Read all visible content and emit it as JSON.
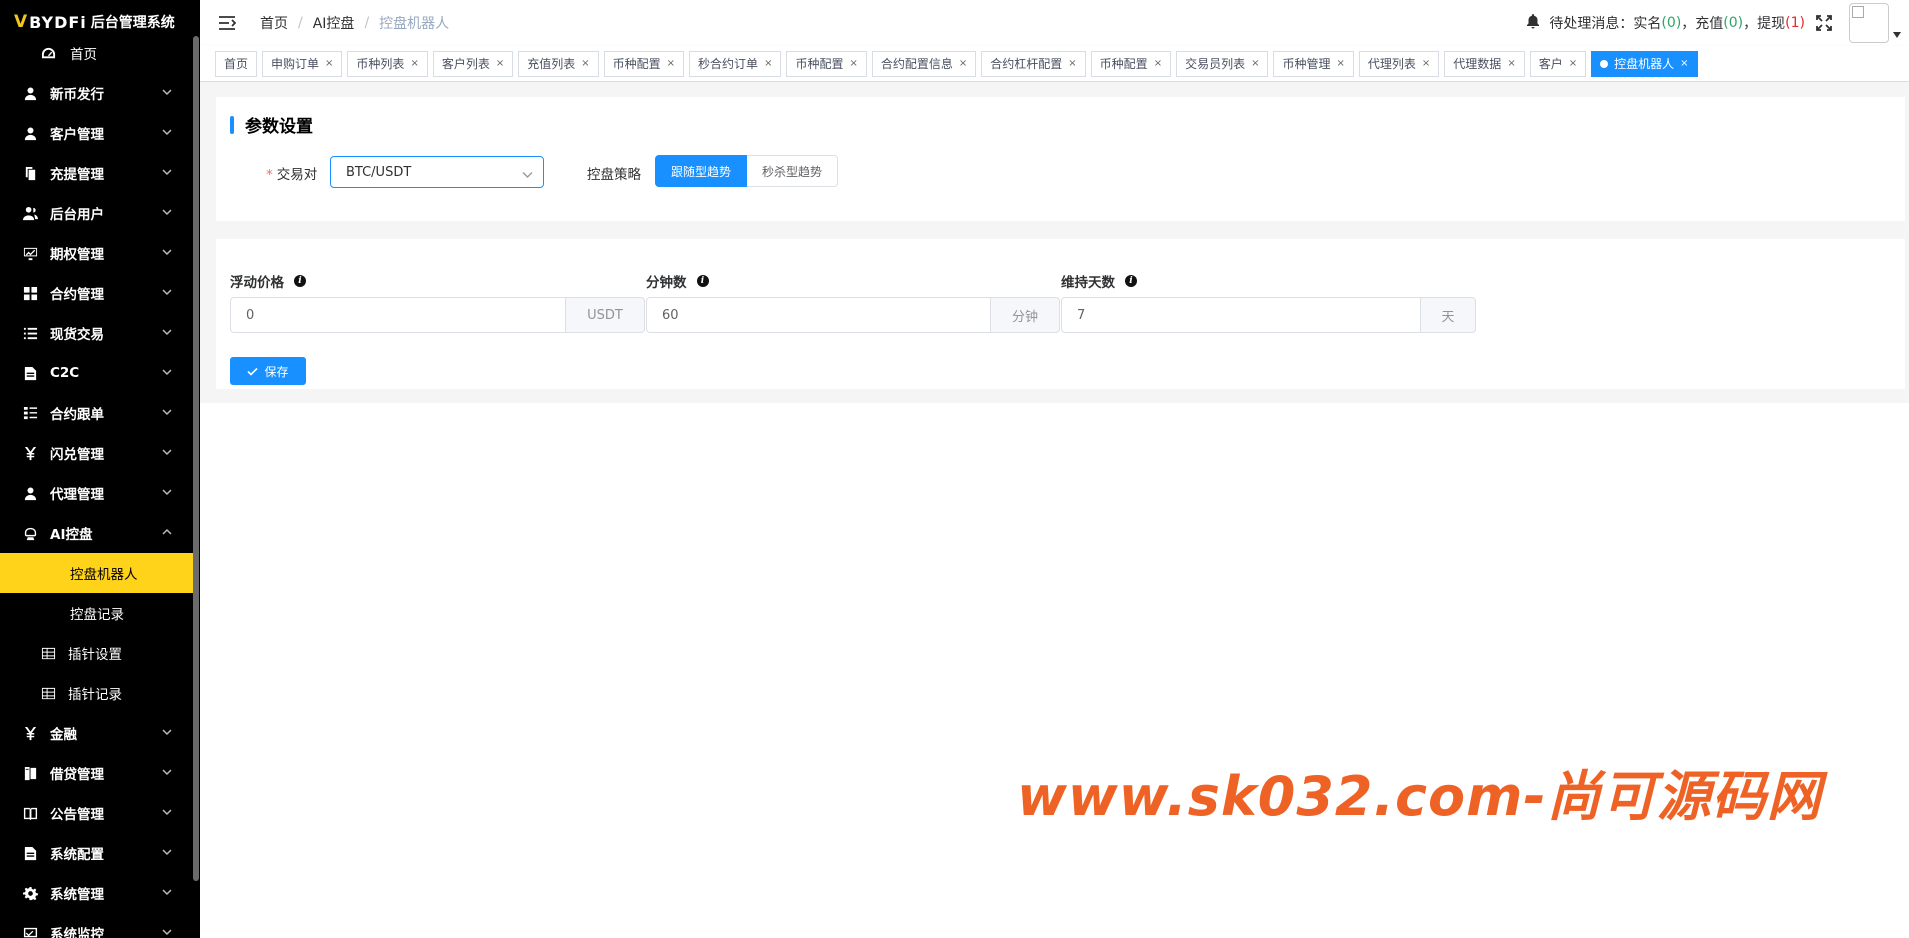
{
  "app": {
    "logo_mark": "V",
    "logo_brand": "BYDFi",
    "logo_sub": "后台管理系统"
  },
  "sidebar": {
    "home": "首页",
    "items": [
      {
        "label": "新币发行",
        "icon": "user-icon"
      },
      {
        "label": "客户管理",
        "icon": "user-icon"
      },
      {
        "label": "充提管理",
        "icon": "copy-icon"
      },
      {
        "label": "后台用户",
        "icon": "users-icon"
      },
      {
        "label": "期权管理",
        "icon": "chart-icon"
      },
      {
        "label": "合约管理",
        "icon": "grid-icon"
      },
      {
        "label": "现货交易",
        "icon": "list-icon"
      },
      {
        "label": "C2C",
        "icon": "doc-icon"
      },
      {
        "label": "合约跟单",
        "icon": "tree-icon"
      },
      {
        "label": "闪兑管理",
        "icon": "yen-icon"
      },
      {
        "label": "代理管理",
        "icon": "user-icon"
      },
      {
        "label": "AI控盘",
        "icon": "robot-icon"
      }
    ],
    "ai_children": [
      {
        "label": "控盘机器人"
      },
      {
        "label": "控盘记录"
      },
      {
        "label": "插针设置"
      },
      {
        "label": "插针记录"
      }
    ],
    "bottom_items": [
      {
        "label": "金融",
        "icon": "yen-icon"
      },
      {
        "label": "借贷管理",
        "icon": "book-icon"
      },
      {
        "label": "公告管理",
        "icon": "open-book-icon"
      },
      {
        "label": "系统配置",
        "icon": "doc-icon"
      },
      {
        "label": "系统管理",
        "icon": "gear-icon"
      },
      {
        "label": "系统监控",
        "icon": "monitor-icon"
      }
    ]
  },
  "header": {
    "breadcrumb": [
      "首页",
      "AI控盘",
      "控盘机器人"
    ],
    "notice_prefix": "待处理消息：",
    "realname_label": "实名",
    "realname_open": "(",
    "realname_count": "0",
    "realname_close": ")",
    "deposit_label": "充值",
    "deposit_count": "0",
    "withdraw_label": "提现",
    "withdraw_count": "1",
    "comma": "，",
    "open": "(",
    "close": ")"
  },
  "tags": [
    "首页",
    "申购订单",
    "币种列表",
    "客户列表",
    "充值列表",
    "币种配置",
    "秒合约订单",
    "币种配置",
    "合约配置信息",
    "合约杠杆配置",
    "币种配置",
    "交易员列表",
    "币种管理",
    "代理列表",
    "代理数据",
    "客户",
    "控盘机器人"
  ],
  "section": {
    "title": "参数设置"
  },
  "form": {
    "pair_label": "交易对",
    "pair_value": "BTC/USDT",
    "strategy_label": "控盘策略",
    "strategy_options": [
      "跟随型趋势",
      "秒杀型趋势"
    ],
    "strategy_selected": "跟随型趋势",
    "float_price_label": "浮动价格",
    "float_price_value": "0",
    "float_price_unit": "USDT",
    "minutes_label": "分钟数",
    "minutes_value": "60",
    "minutes_unit": "分钟",
    "days_label": "维持天数",
    "days_value": "7",
    "days_unit": "天",
    "save_label": "保存"
  },
  "watermark": "www.sk032.com-尚可源码网",
  "colors": {
    "primary": "#1890ff",
    "sidebar_bg": "#000000",
    "active_menu": "#ffd31a",
    "watermark": "#ef6226"
  }
}
